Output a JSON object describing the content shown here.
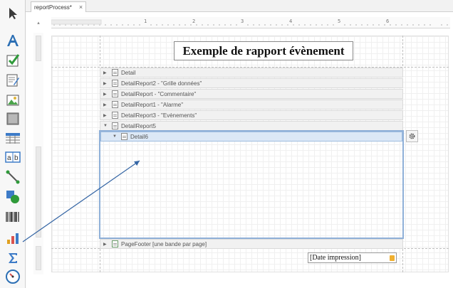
{
  "tab": {
    "label": "reportProcess*",
    "close": "×"
  },
  "ruler": {
    "corner": "▴",
    "marks": [
      "1",
      "2",
      "3",
      "4",
      "5",
      "6"
    ]
  },
  "report": {
    "title": "Exemple de rapport évènement",
    "date_field": "[Date impression]"
  },
  "bands": [
    {
      "label": "Detail",
      "arrow": "▶"
    },
    {
      "label": "DetailReport2 - \"Grille données\"",
      "arrow": "▶"
    },
    {
      "label": "DetailReport - \"Commentaire\"",
      "arrow": "▶"
    },
    {
      "label": "DetailReport1 - \"Alarme\"",
      "arrow": "▶"
    },
    {
      "label": "DetailReport3 - \"Evènements\"",
      "arrow": "▶"
    },
    {
      "label": "DetailReport5",
      "arrow": "▼"
    },
    {
      "label": "Detail6",
      "arrow": "▼"
    },
    {
      "label": "PageFooter [une bande par page]",
      "arrow": "▶"
    }
  ],
  "toolbox": [
    "pointer-icon",
    "label-icon",
    "checkbox-icon",
    "richtext-icon",
    "picture-icon",
    "panel-icon",
    "table-icon",
    "character-comb-icon",
    "line-icon",
    "shape-icon",
    "barcode-icon",
    "chart-icon",
    "summary-icon",
    "gauge-icon"
  ]
}
